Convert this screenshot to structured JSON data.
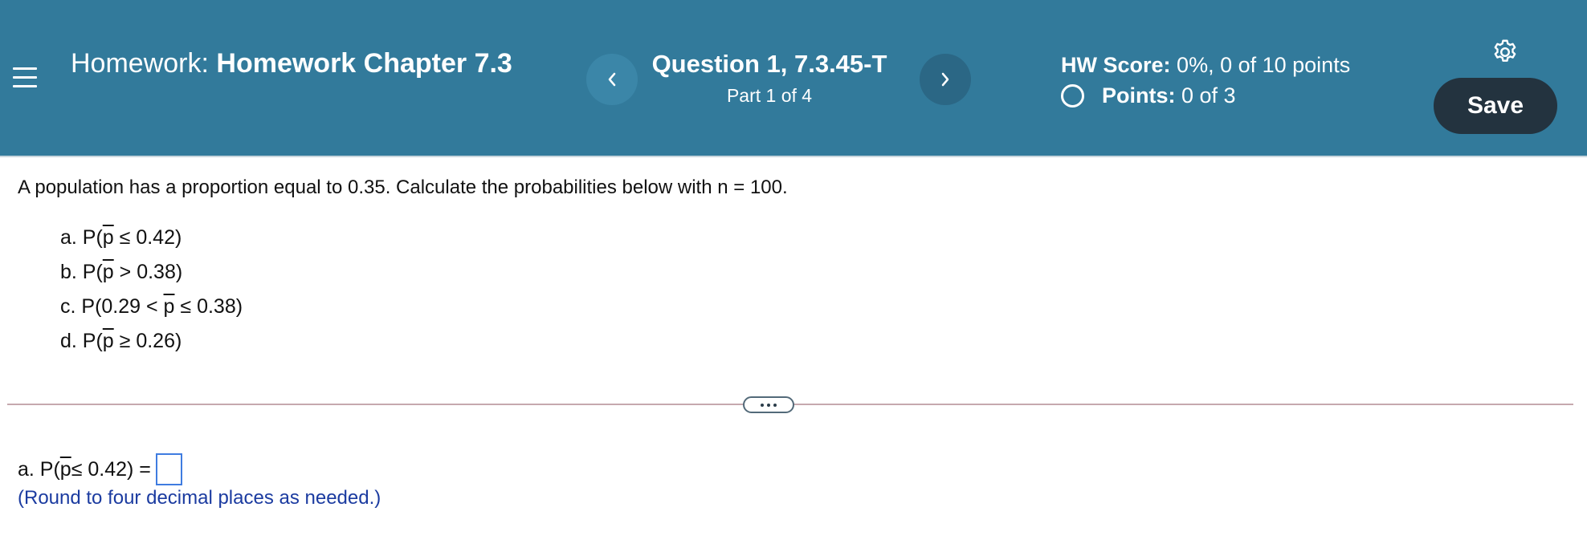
{
  "header": {
    "homework_label": "Homework:",
    "homework_name": "Homework Chapter 7.3",
    "question_title": "Question 1, 7.3.45-T",
    "question_part": "Part 1 of 4",
    "score_label": "HW Score:",
    "score_value": "0%, 0 of 10 points",
    "points_label": "Points:",
    "points_value": "0 of 3",
    "save_label": "Save"
  },
  "question": {
    "prompt": "A population has a proportion equal to 0.35. Calculate the probabilities below with n = 100.",
    "parts": [
      {
        "pre": "a. P(",
        "phat": "p",
        "post": " ≤ 0.42)"
      },
      {
        "pre": "b. P(",
        "phat": "p",
        "post": " > 0.38)"
      },
      {
        "pre": "c. P(0.29 < ",
        "phat": "p",
        "post": " ≤ 0.38)"
      },
      {
        "pre": "d. P(",
        "phat": "p",
        "post": " ≥ 0.26)"
      }
    ]
  },
  "answer": {
    "pre": "a. P(",
    "phat": "p",
    "post": " ≤ 0.42) =",
    "value": "",
    "hint": "(Round to four decimal places as needed.)"
  },
  "colors": {
    "header_bg": "#327a9b",
    "save_bg": "#23333f",
    "hint_text": "#1b3ba0",
    "input_border": "#3f7ce0"
  }
}
